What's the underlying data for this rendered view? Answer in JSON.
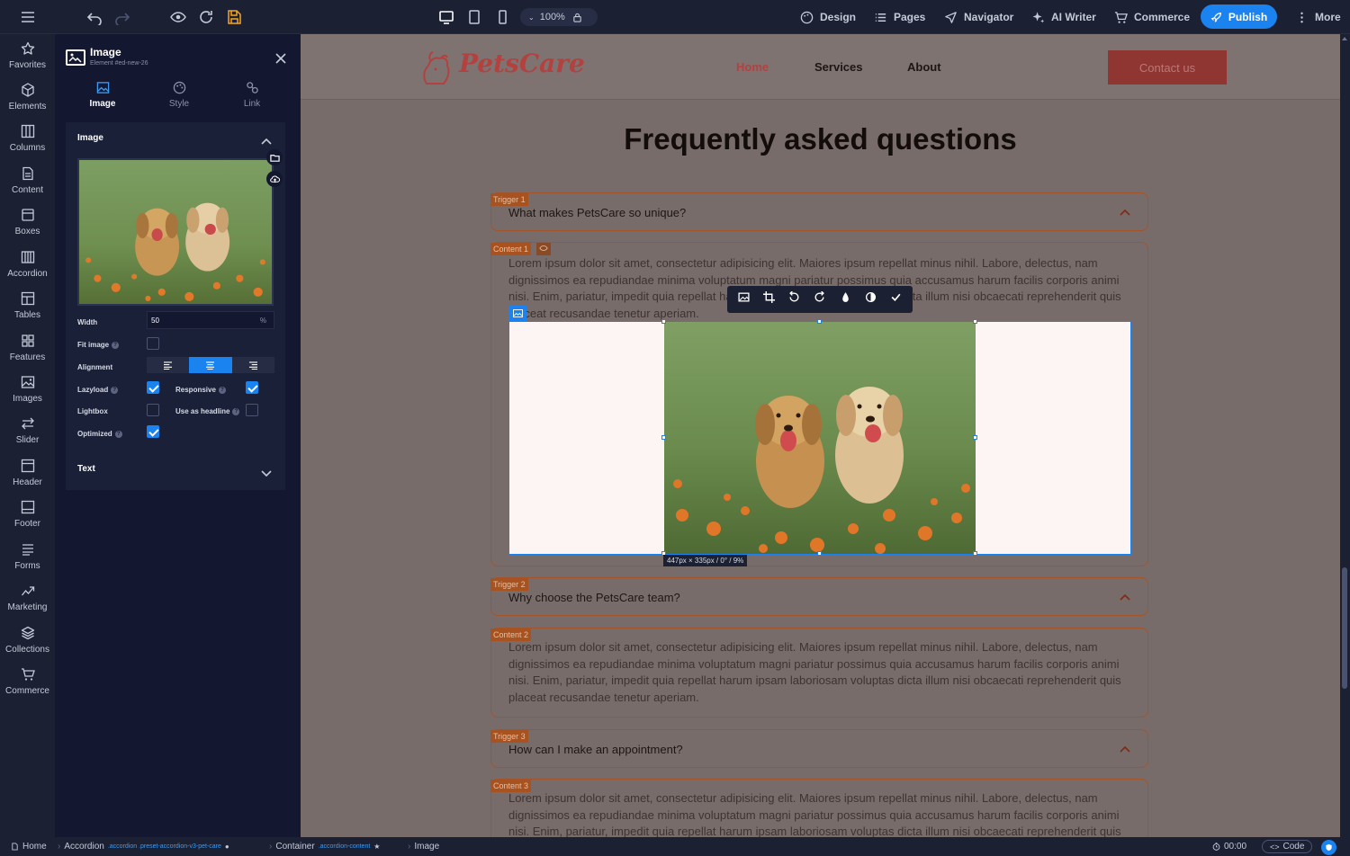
{
  "topbar": {
    "zoom": "100%",
    "menu": [
      "Design",
      "Pages",
      "Navigator",
      "AI Writer",
      "Commerce"
    ],
    "publish": "Publish",
    "more": "More"
  },
  "leftnav": [
    "Favorites",
    "Elements",
    "Columns",
    "Content",
    "Boxes",
    "Accordion",
    "Tables",
    "Features",
    "Images",
    "Slider",
    "Header",
    "Footer",
    "Forms",
    "Marketing",
    "Collections",
    "Commerce"
  ],
  "panel": {
    "title": "Image",
    "subtitle": "Element #ed-new-26",
    "tabs": [
      "Image",
      "Style",
      "Link"
    ],
    "section_image": "Image",
    "width_label": "Width",
    "width_value": "50",
    "width_unit": "%",
    "fit_label": "Fit image",
    "alignment_label": "Alignment",
    "lazyload_label": "Lazyload",
    "responsive_label": "Responsive",
    "lightbox_label": "Lightbox",
    "headline_label": "Use as headline",
    "optimized_label": "Optimized",
    "section_text": "Text"
  },
  "site": {
    "logo": "PetsCare",
    "nav": [
      "Home",
      "Services",
      "About"
    ],
    "contact": "Contact us",
    "faq_title": "Frequently asked questions",
    "tags": [
      "Trigger 1",
      "Content 1",
      "Trigger 2",
      "Content 2",
      "Trigger 3",
      "Content 3"
    ],
    "questions": [
      "What makes PetsCare so unique?",
      "Why choose the PetsCare team?",
      "How can I make an appointment?"
    ],
    "lorem": "Lorem ipsum dolor sit amet, consectetur adipisicing elit. Maiores ipsum repellat minus nihil. Labore, delectus, nam dignissimos ea repudiandae minima voluptatum magni pariatur possimus quia accusamus harum facilis corporis animi nisi. Enim, pariatur, impedit quia repellat harum ipsam laboriosam voluptas dicta illum nisi obcaecati reprehenderit quis placeat recusandae tenetur aperiam.",
    "size_badge": "447px × 335px / 0° / 9%"
  },
  "bottombar": {
    "home": "Home",
    "accordion": "Accordion",
    "accordion_cls": ".accordion .preset-accordion-v3-pet-care",
    "container": "Container",
    "container_cls": ".accordion-content",
    "image": "Image",
    "time": "00:00",
    "code": "Code"
  },
  "colors": {
    "accent": "#1a83f0",
    "brand": "#a8521f"
  }
}
